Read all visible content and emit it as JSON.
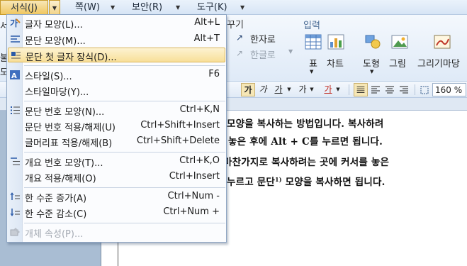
{
  "menubar": {
    "items": [
      {
        "label": "서식(J)"
      },
      {
        "label": "쪽(W)"
      },
      {
        "label": "보안(R)"
      },
      {
        "label": "도구(K)"
      }
    ]
  },
  "ribbon": {
    "left_fragments": [
      "서",
      "불",
      "도"
    ],
    "fragment_kkugi": "꾸기",
    "hanja_label": "한자로",
    "hangul_label": "한글로",
    "input_group_label": "입력",
    "buttons": [
      {
        "label": "표"
      },
      {
        "label": "차트"
      },
      {
        "label": "도형"
      },
      {
        "label": "그림"
      },
      {
        "label": "그리기마당"
      }
    ]
  },
  "format_toolbar": {
    "char_buttons": [
      "가",
      "가",
      "가",
      "가",
      "가"
    ],
    "zoom": "160 %"
  },
  "dropdown": {
    "items": [
      {
        "label": "글자 모양(L)...",
        "shortcut": "Alt+L",
        "icon": "char-shape-icon",
        "highlighted": false,
        "disabled": false
      },
      {
        "label": "문단 모양(M)...",
        "shortcut": "Alt+T",
        "icon": "para-shape-icon",
        "highlighted": false,
        "disabled": false
      },
      {
        "label": "문단 첫 글자 장식(D)...",
        "shortcut": "",
        "icon": "drop-cap-icon",
        "highlighted": true,
        "disabled": false
      },
      {
        "label": "스타일(S)...",
        "shortcut": "F6",
        "icon": "style-icon",
        "highlighted": false,
        "disabled": false
      },
      {
        "label": "스타일마당(Y)...",
        "shortcut": "",
        "icon": "",
        "highlighted": false,
        "disabled": false
      },
      {
        "label": "문단 번호 모양(N)...",
        "shortcut": "Ctrl+K,N",
        "icon": "para-number-icon",
        "highlighted": false,
        "disabled": false
      },
      {
        "label": "문단 번호 적용/해제(U)",
        "shortcut": "Ctrl+Shift+Insert",
        "icon": "",
        "highlighted": false,
        "disabled": false
      },
      {
        "label": "글머리표 적용/해제(B)",
        "shortcut": "Ctrl+Shift+Delete",
        "icon": "",
        "highlighted": false,
        "disabled": false
      },
      {
        "label": "개요 번호 모양(T)...",
        "shortcut": "Ctrl+K,O",
        "icon": "outline-number-icon",
        "highlighted": false,
        "disabled": false
      },
      {
        "label": "개요 적용/해제(O)",
        "shortcut": "Ctrl+Insert",
        "icon": "",
        "highlighted": false,
        "disabled": false
      },
      {
        "label": "한 수준 증가(A)",
        "shortcut": "Ctrl+Num -",
        "icon": "level-up-icon",
        "highlighted": false,
        "disabled": false
      },
      {
        "label": "한 수준 감소(C)",
        "shortcut": "Ctrl+Num +",
        "icon": "level-down-icon",
        "highlighted": false,
        "disabled": false
      },
      {
        "label": "개체 속성(P)...",
        "shortcut": "",
        "icon": "object-props-icon",
        "highlighted": false,
        "disabled": true
      }
    ]
  },
  "document": {
    "lines": [
      "모양을 복사하는 방법입니다. 복사하려",
      "놓은 후에 Alt + C를 누르면 됩니다.",
      "마찬가지로 복사하려는 곳에 커서를 놓은",
      "누르고 문단",
      "모양을 복사하면 됩니다."
    ],
    "footnote_mark": "1)"
  }
}
